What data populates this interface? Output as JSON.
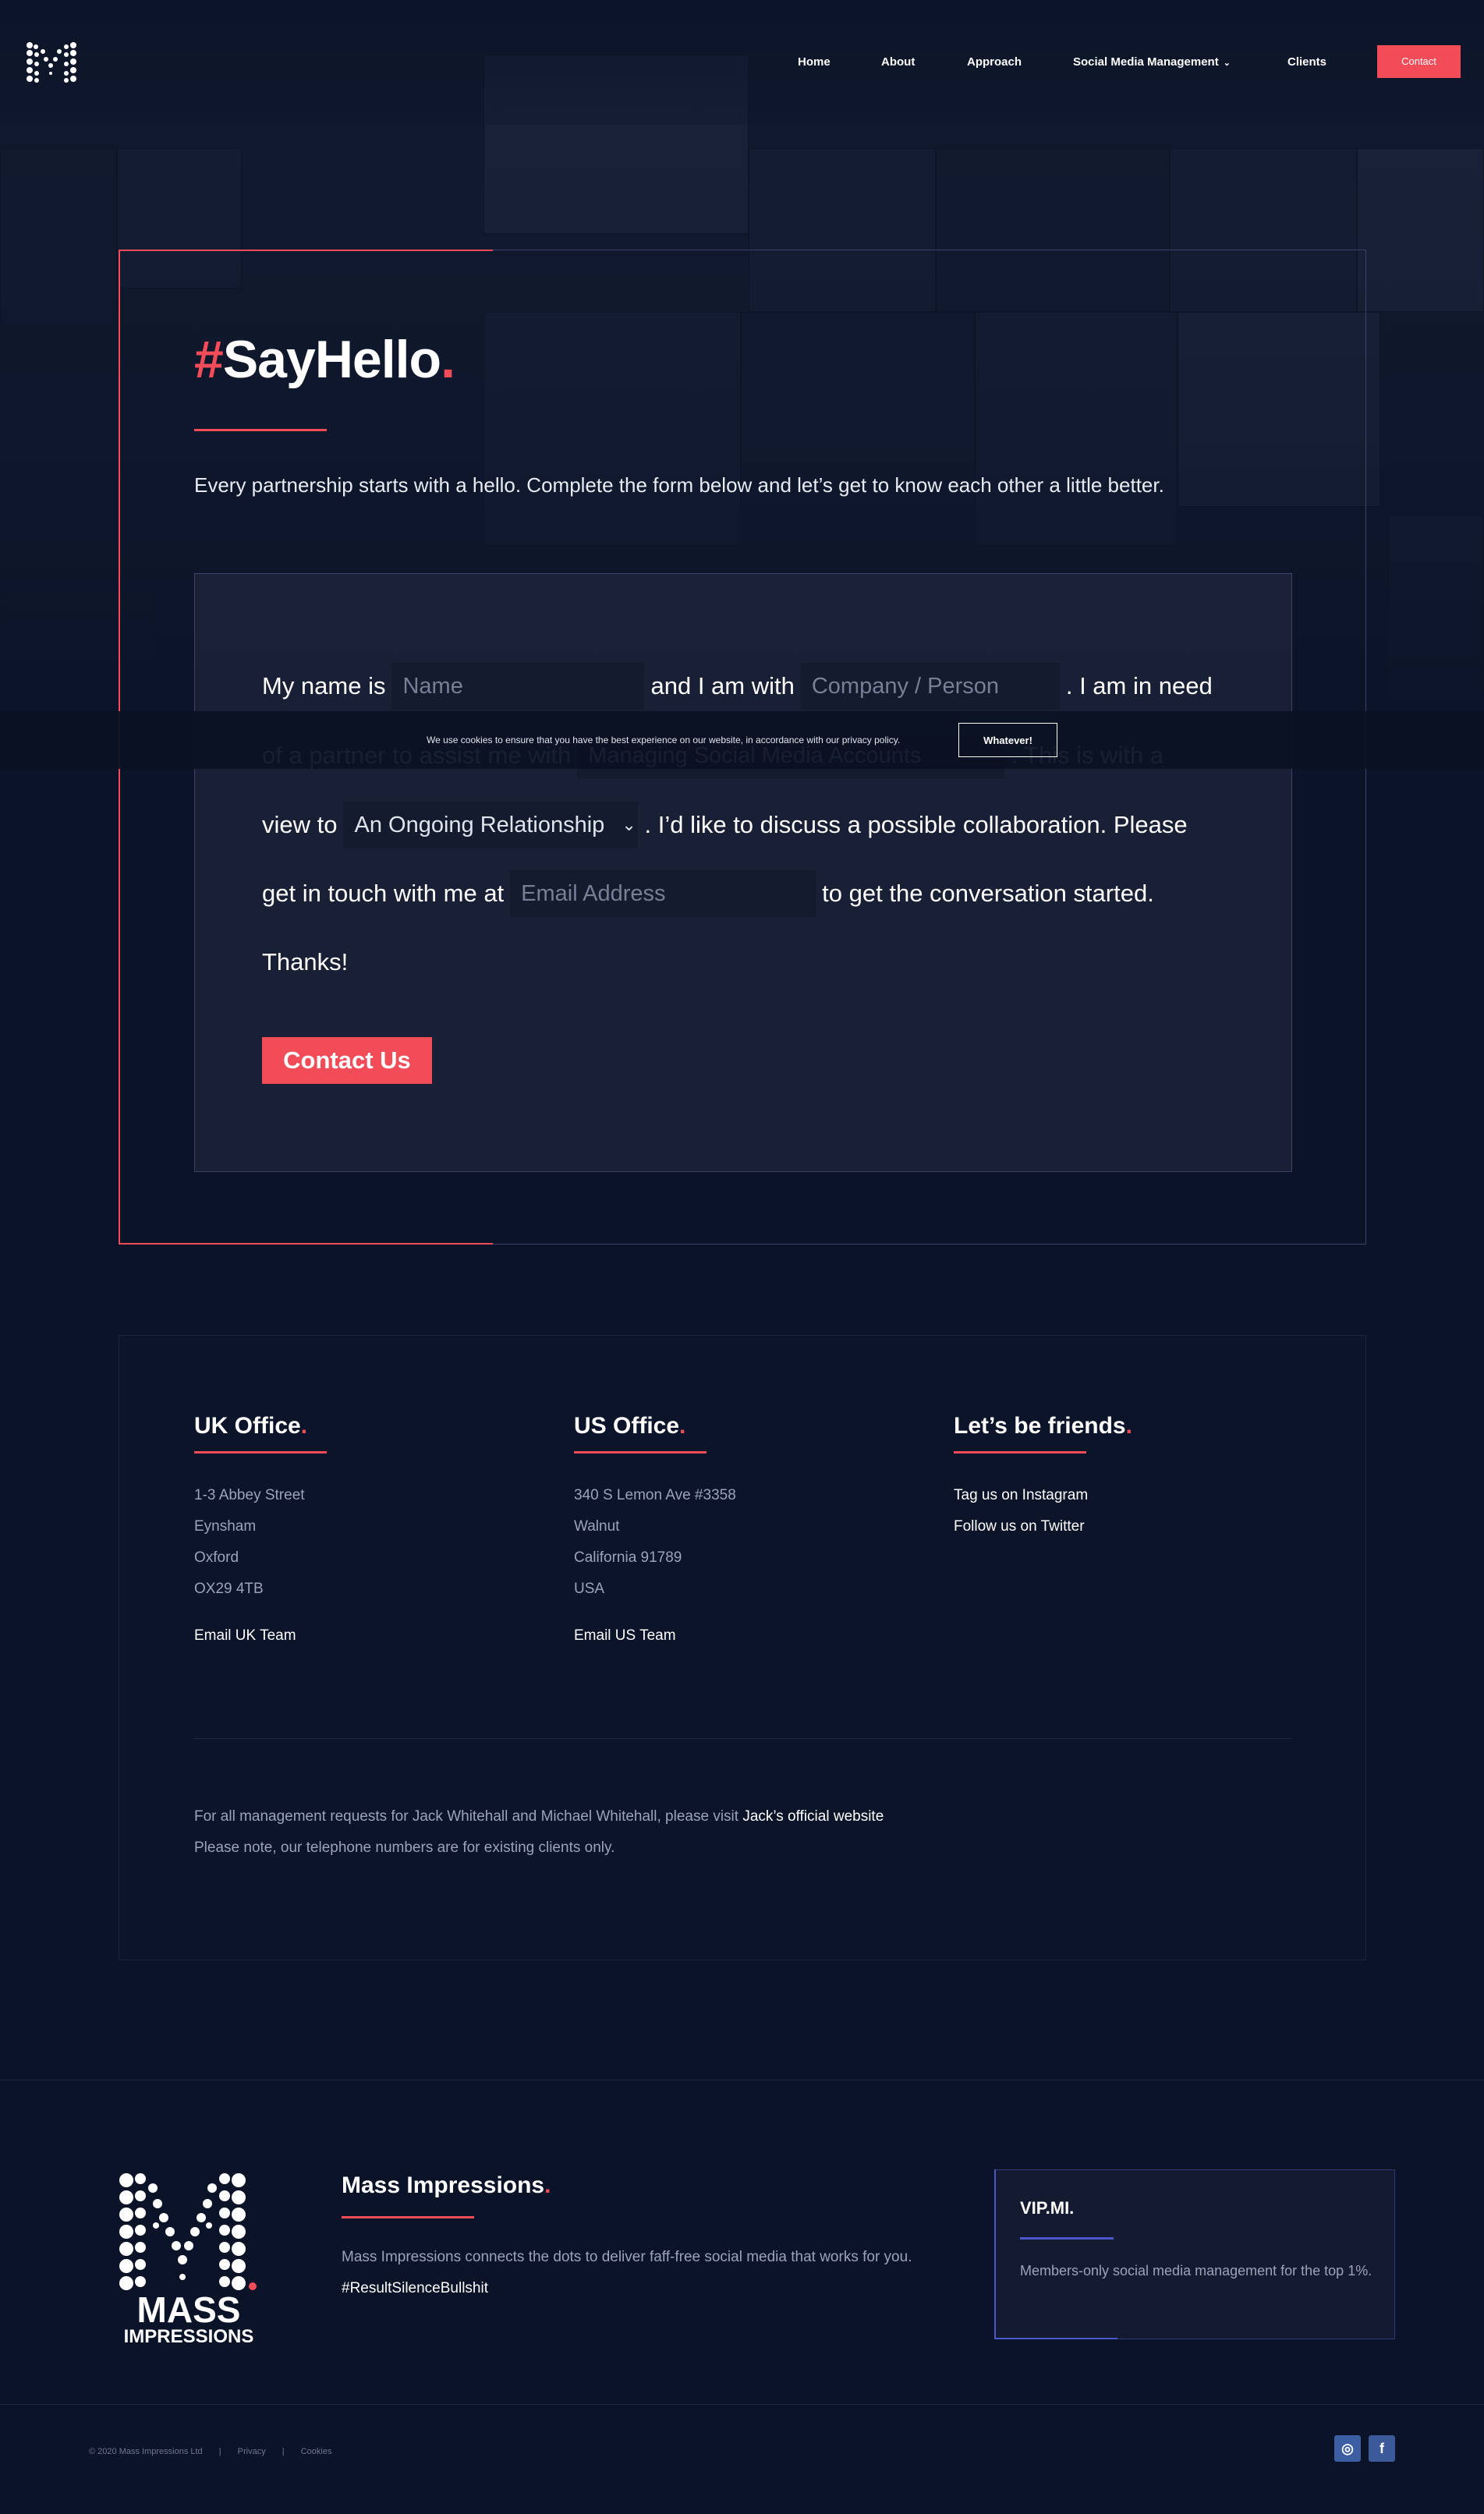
{
  "header": {
    "nav": [
      {
        "label": "Home"
      },
      {
        "label": "About"
      },
      {
        "label": "Approach"
      },
      {
        "label": "Social Media Management"
      },
      {
        "label": "Clients"
      }
    ],
    "contact_label": "Contact"
  },
  "hero": {
    "title_hash": "#",
    "title_text": "SayHello",
    "title_dot": ".",
    "intro": "Every partnership starts with a hello. Complete the form below and let’s get to know each other a little better."
  },
  "form": {
    "t1": "My name is",
    "name_placeholder": "Name",
    "t2": "and I am with",
    "company_placeholder": "Company / Person",
    "t3": ". I am in need",
    "t4": "of a partner to assist me with",
    "service_value": "Managing Social Media Accounts",
    "t5": ". This is with a",
    "t6": "view to",
    "relationship_value": "An Ongoing Relationship",
    "t7": ". I’d like to discuss a possible collaboration. Please",
    "t8": "get in touch with me at",
    "email_placeholder": "Email Address",
    "t9": "to get the conversation started.",
    "t10": "Thanks!",
    "submit_label": "Contact Us"
  },
  "cookie": {
    "text": "We use cookies to ensure that you have the best experience on our website, in accordance with our privacy policy.",
    "button": "Whatever!"
  },
  "offices": {
    "uk": {
      "title": "UK Office",
      "dot": ".",
      "lines": [
        "1-3 Abbey Street",
        "Eynsham",
        "Oxford",
        "OX29 4TB"
      ],
      "email_link": "Email UK Team"
    },
    "us": {
      "title": "US Office",
      "dot": ".",
      "lines": [
        "340 S Lemon Ave #3358",
        "Walnut",
        "California 91789",
        "USA"
      ],
      "email_link": "Email US Team"
    },
    "friends": {
      "title": "Let’s be friends",
      "dot": ".",
      "links": [
        "Tag us on Instagram",
        "Follow us on Twitter"
      ]
    },
    "note1_text": "For all management requests for Jack Whitehall and Michael Whitehall, please visit ",
    "note1_link": "Jack’s official website",
    "note2": "Please note, our telephone numbers are for existing clients only."
  },
  "footer": {
    "logo_line1": "MASS",
    "logo_line2": "IMPRESSIONS",
    "mi_title": "Mass Impressions",
    "mi_dot": ".",
    "mi_text": "Mass Impressions connects the dots to deliver faff-free social media that works for you. ",
    "mi_hashtag": "#ResultSilenceBullshit",
    "vip_title": "VIP.MI.",
    "vip_text": "Members-only social media management for the top 1%.",
    "copyright": "© 2020 Mass Impressions Ltd",
    "sep": "|",
    "privacy": "Privacy",
    "cookies": "Cookies",
    "social": [
      {
        "icon": "instagram-icon",
        "glyph": "◎"
      },
      {
        "icon": "facebook-icon",
        "glyph": "f"
      }
    ]
  },
  "colors": {
    "accent": "#f24c59",
    "background": "#0b1328",
    "vip_accent": "#4b57c9"
  }
}
